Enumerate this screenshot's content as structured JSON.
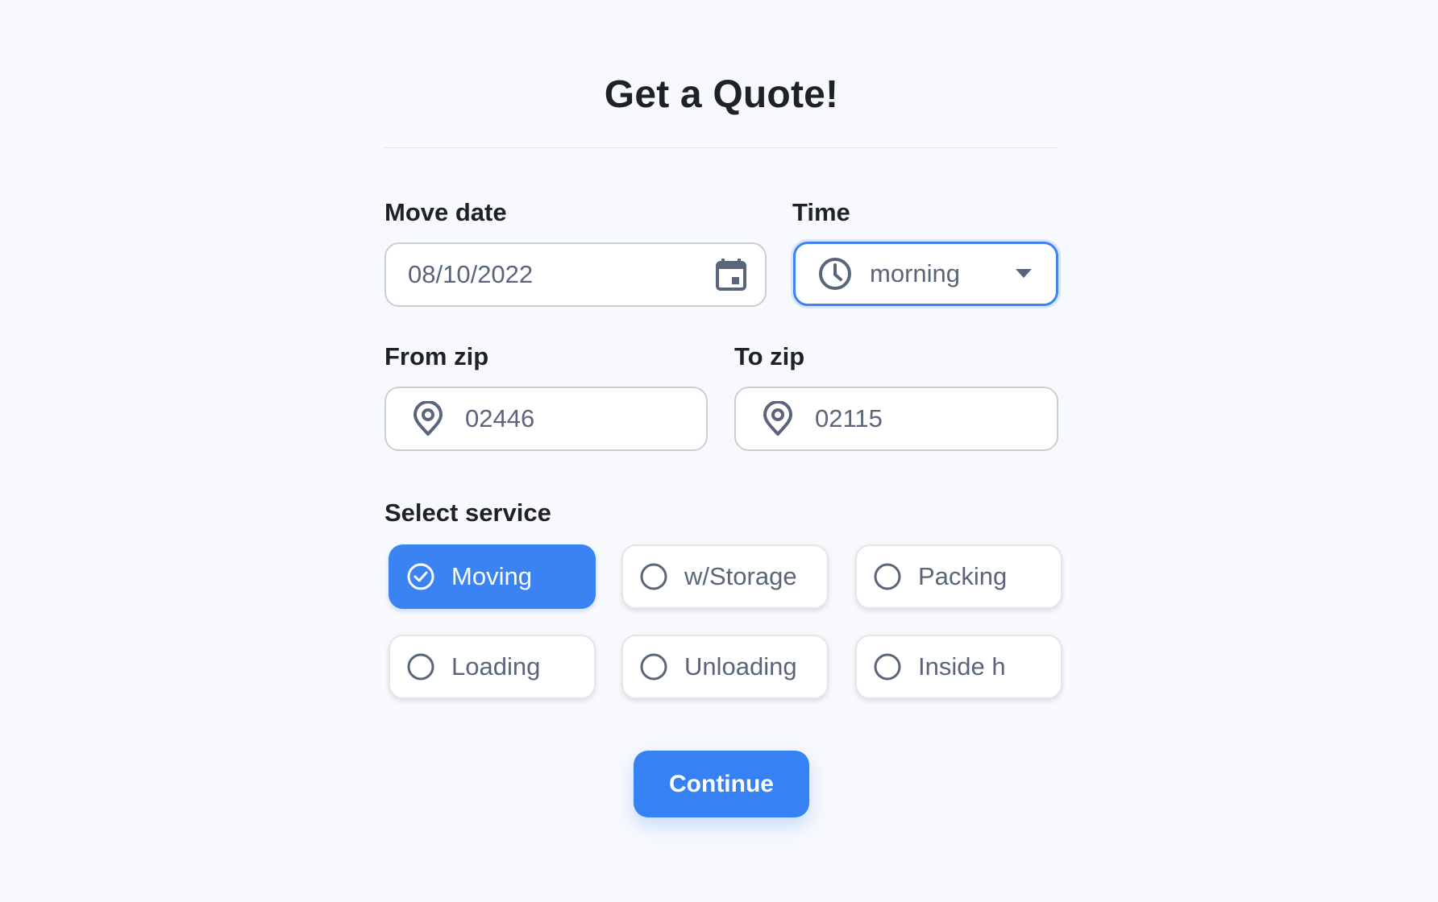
{
  "form": {
    "title": "Get a Quote!",
    "move_date": {
      "label": "Move date",
      "value": "08/10/2022",
      "icon": "calendar-icon"
    },
    "time": {
      "label": "Time",
      "value": "morning",
      "icon": "clock-icon",
      "dropdown_icon": "caret-down-icon"
    },
    "from_zip": {
      "label": "From zip",
      "value": "02446",
      "icon": "map-pin-icon"
    },
    "to_zip": {
      "label": "To zip",
      "value": "02115",
      "icon": "map-pin-icon"
    },
    "service": {
      "label": "Select service",
      "options": [
        {
          "label": "Moving",
          "selected": true
        },
        {
          "label": "w/Storage",
          "selected": false
        },
        {
          "label": "Packing",
          "selected": false
        },
        {
          "label": "Loading",
          "selected": false
        },
        {
          "label": "Unloading",
          "selected": false
        },
        {
          "label": "Inside h",
          "selected": false
        }
      ]
    },
    "continue_label": "Continue"
  },
  "colors": {
    "accent": "#3b82f2",
    "background": "#f7f9fc",
    "muted_text": "#59657a",
    "heading_text": "#1e2125"
  }
}
